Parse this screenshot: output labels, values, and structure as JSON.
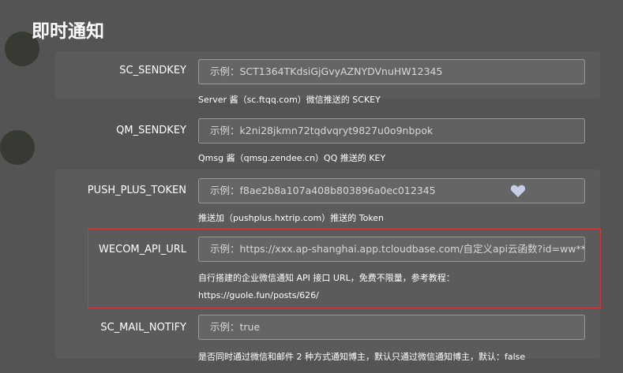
{
  "title": "即时通知",
  "fields": [
    {
      "label": "SC_SENDKEY",
      "placeholder": "示例：SCT1364TKdsiGjGvyAZNYDVnuHW12345",
      "help": [
        "Server 酱（sc.ftqq.com）微信推送的 SCKEY"
      ]
    },
    {
      "label": "QM_SENDKEY",
      "placeholder": "示例：k2ni28jkmn72tqdvqryt9827u0o9nbpok",
      "help": [
        "Qmsg 酱（qmsg.zendee.cn）QQ 推送的 KEY"
      ]
    },
    {
      "label": "PUSH_PLUS_TOKEN",
      "placeholder": "示例：f8ae2b8a107a408b803896a0ec012345",
      "help": [
        "推送加（pushplus.hxtrip.com）推送的 Token"
      ]
    },
    {
      "label": "WECOM_API_URL",
      "placeholder": "示例：https://xxx.ap-shanghai.app.tcloudbase.com/自定义api云函数?id=ww***&",
      "help": [
        "自行搭建的企业微信通知 API 接口 URL，免费不限量，参考教程：",
        "https://guole.fun/posts/626/"
      ]
    },
    {
      "label": "SC_MAIL_NOTIFY",
      "placeholder": "示例：true",
      "help": [
        "是否同时通过微信和邮件 2 种方式通知博主，默认只通过微信通知博主，默认：false"
      ]
    }
  ],
  "highlight_color": "#d23a3a",
  "icons": {
    "heart": "heart-icon"
  }
}
